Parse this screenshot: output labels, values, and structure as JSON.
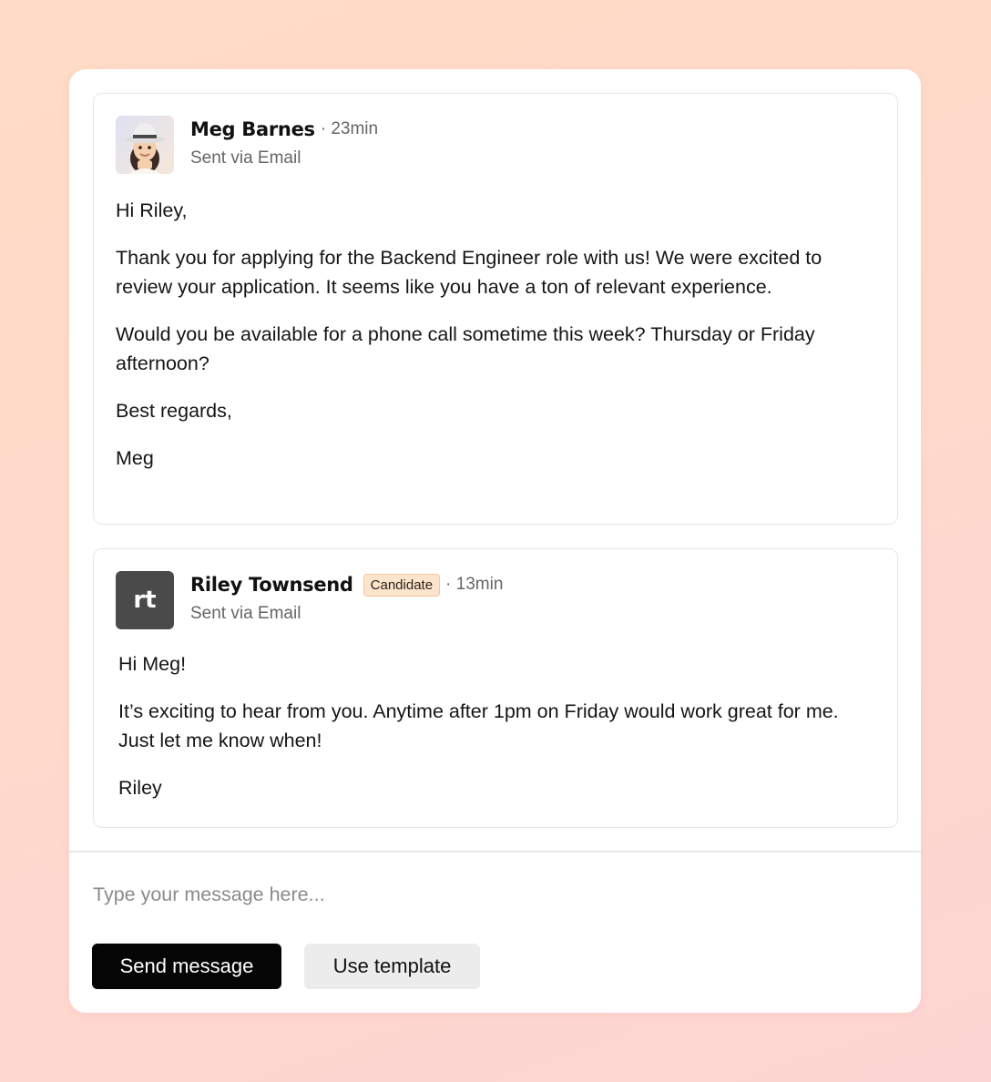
{
  "thread": {
    "messages": [
      {
        "sender": "Meg Barnes",
        "time": "23min",
        "via": "Sent via Email",
        "avatar": {
          "type": "memoji",
          "icon": "woman-with-hat-avatar-icon"
        },
        "badge": null,
        "paragraphs": [
          "Hi Riley,",
          "Thank you for applying for the Backend Engineer role with us! We were excited to review your application. It seems like you have a ton of relevant experience.",
          "Would you be available for a phone call sometime this week? Thursday or Friday afternoon?",
          "Best regards,",
          "Meg"
        ]
      },
      {
        "sender": "Riley Townsend",
        "time": "13min",
        "via": "Sent via Email",
        "avatar": {
          "type": "initials",
          "initials": "rt"
        },
        "badge": "Candidate",
        "paragraphs": [
          "Hi Meg!",
          "It’s exciting to hear from you. Anytime after 1pm on Friday would work great for me. Just let me know when!",
          "Riley"
        ]
      }
    ]
  },
  "composer": {
    "placeholder": "Type your message here...",
    "value": "",
    "send_label": "Send message",
    "template_label": "Use template"
  },
  "colors": {
    "primary_button": "#050505",
    "secondary_button": "#ececec",
    "badge_background": "#fde4cc",
    "badge_border": "#f7c79e",
    "initials_avatar": "#4a4a4a"
  }
}
